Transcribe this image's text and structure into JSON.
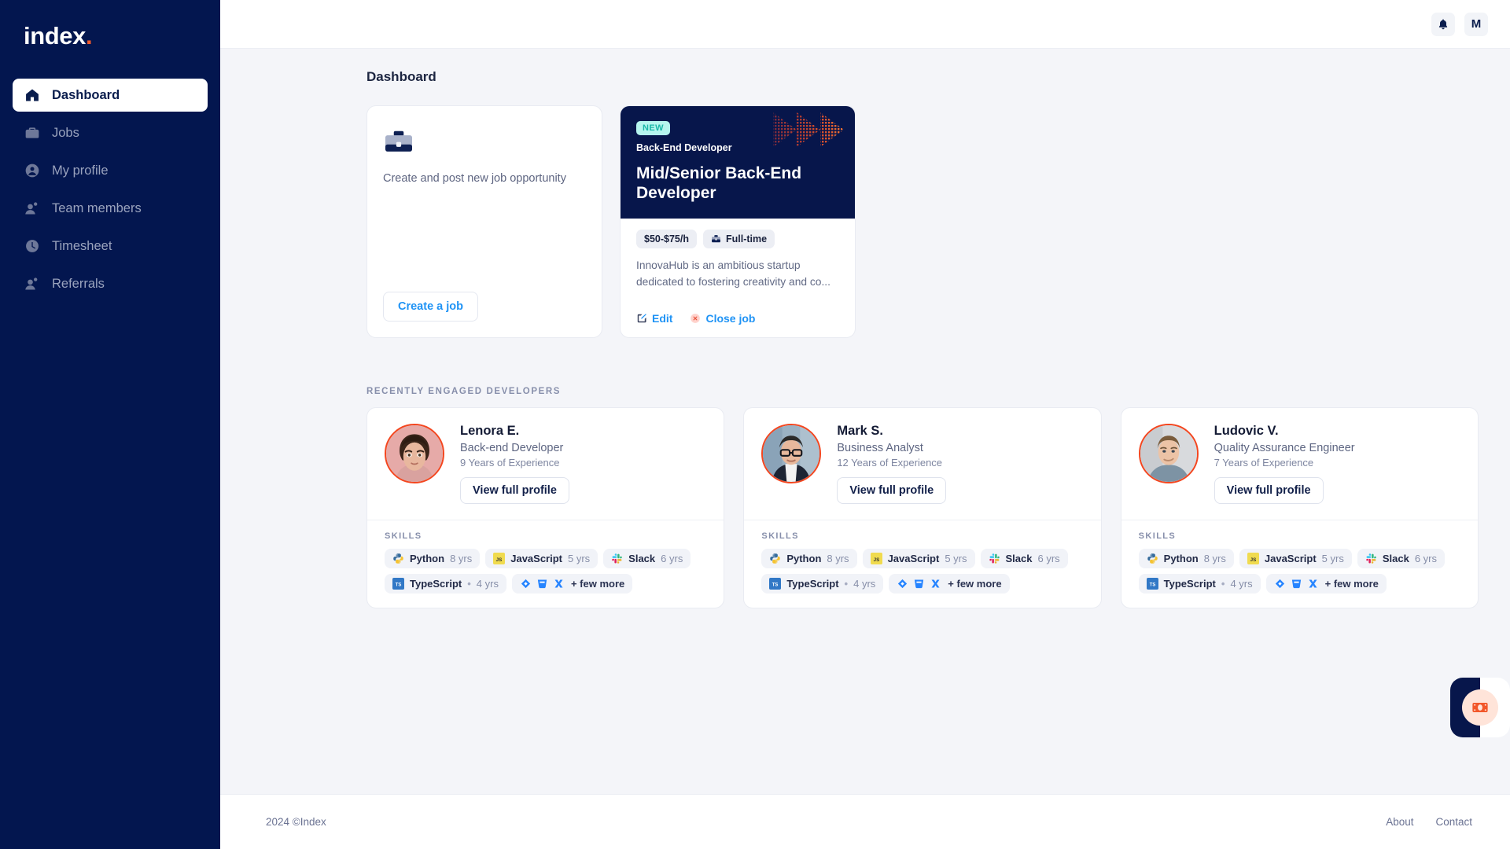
{
  "sidebar": {
    "logo_text": "index",
    "logo_dot": ".",
    "items": [
      {
        "label": "Dashboard",
        "icon": "home-icon",
        "active": true
      },
      {
        "label": "Jobs",
        "icon": "briefcase-icon",
        "active": false
      },
      {
        "label": "My profile",
        "icon": "user-circle-icon",
        "active": false
      },
      {
        "label": "Team members",
        "icon": "users-icon",
        "active": false
      },
      {
        "label": "Timesheet",
        "icon": "clock-icon",
        "active": false
      },
      {
        "label": "Referrals",
        "icon": "users-icon",
        "active": false
      }
    ]
  },
  "topbar": {
    "notifications_icon": "bell-icon",
    "avatar_initial": "M"
  },
  "page": {
    "title": "Dashboard"
  },
  "create_card": {
    "icon": "briefcase-icon",
    "text": "Create and post new job opportunity",
    "button_label": "Create a job"
  },
  "job_card": {
    "badge": "NEW",
    "category": "Back-End Developer",
    "title": "Mid/Senior Back-End Developer",
    "rate_tag": "$50-$75/h",
    "type_tag": "Full-time",
    "type_icon": "briefcase-icon",
    "description": "InnovaHub is an ambitious startup dedicated to fostering creativity and co...",
    "edit_label": "Edit",
    "edit_icon": "pencil-square-icon",
    "close_label": "Close job",
    "close_icon": "close-circle-icon",
    "header_decoration": "chevron-arrows-icon"
  },
  "developers_section": {
    "label": "RECENTLY ENGAGED DEVELOPERS",
    "skills_label": "SKILLS",
    "view_profile_label": "View full profile",
    "cards": [
      {
        "name": "Lenora E.",
        "role": "Back-end Developer",
        "experience": "9 Years of Experience",
        "avatar": "avatar-lenora",
        "skills": [
          {
            "icon": "python-icon",
            "name": "Python",
            "years": "8 yrs"
          },
          {
            "icon": "javascript-icon",
            "name": "JavaScript",
            "years": "5 yrs"
          },
          {
            "icon": "slack-icon",
            "name": "Slack",
            "years": "6 yrs"
          },
          {
            "icon": "typescript-icon",
            "name": "TypeScript",
            "sep": "•",
            "years": "4 yrs"
          }
        ],
        "more_label": "+ few more",
        "more_icons": [
          "diamond-icon",
          "trash-icon",
          "scissors-icon"
        ]
      },
      {
        "name": "Mark S.",
        "role": "Business Analyst",
        "experience": "12 Years of Experience",
        "avatar": "avatar-mark",
        "skills": [
          {
            "icon": "python-icon",
            "name": "Python",
            "years": "8 yrs"
          },
          {
            "icon": "javascript-icon",
            "name": "JavaScript",
            "years": "5 yrs"
          },
          {
            "icon": "slack-icon",
            "name": "Slack",
            "years": "6 yrs"
          },
          {
            "icon": "typescript-icon",
            "name": "TypeScript",
            "sep": "•",
            "years": "4 yrs"
          }
        ],
        "more_label": "+ few more",
        "more_icons": [
          "diamond-icon",
          "trash-icon",
          "scissors-icon"
        ]
      },
      {
        "name": "Ludovic V.",
        "role": "Quality Assurance Engineer",
        "experience": "7 Years of Experience",
        "avatar": "avatar-ludovic",
        "skills": [
          {
            "icon": "python-icon",
            "name": "Python",
            "years": "8 yrs"
          },
          {
            "icon": "javascript-icon",
            "name": "JavaScript",
            "years": "5 yrs"
          },
          {
            "icon": "slack-icon",
            "name": "Slack",
            "years": "6 yrs"
          },
          {
            "icon": "typescript-icon",
            "name": "TypeScript",
            "sep": "•",
            "years": "4 yrs"
          }
        ],
        "more_label": "+ few more",
        "more_icons": [
          "diamond-icon",
          "trash-icon",
          "scissors-icon"
        ]
      }
    ]
  },
  "fab": {
    "icon": "money-icon"
  },
  "footer": {
    "copyright": "2024 ©Index",
    "links": [
      "About",
      "Contact"
    ]
  },
  "colors": {
    "sidebar_bg": "#03164f",
    "job_header_bg": "#07164b",
    "accent_orange": "#f15a2b",
    "link_blue": "#1f93f5",
    "new_badge_bg": "#b5f5ee",
    "new_badge_text": "#1ab7a8",
    "content_bg": "#f4f5f9",
    "avatar_ring": "#f4461f"
  }
}
